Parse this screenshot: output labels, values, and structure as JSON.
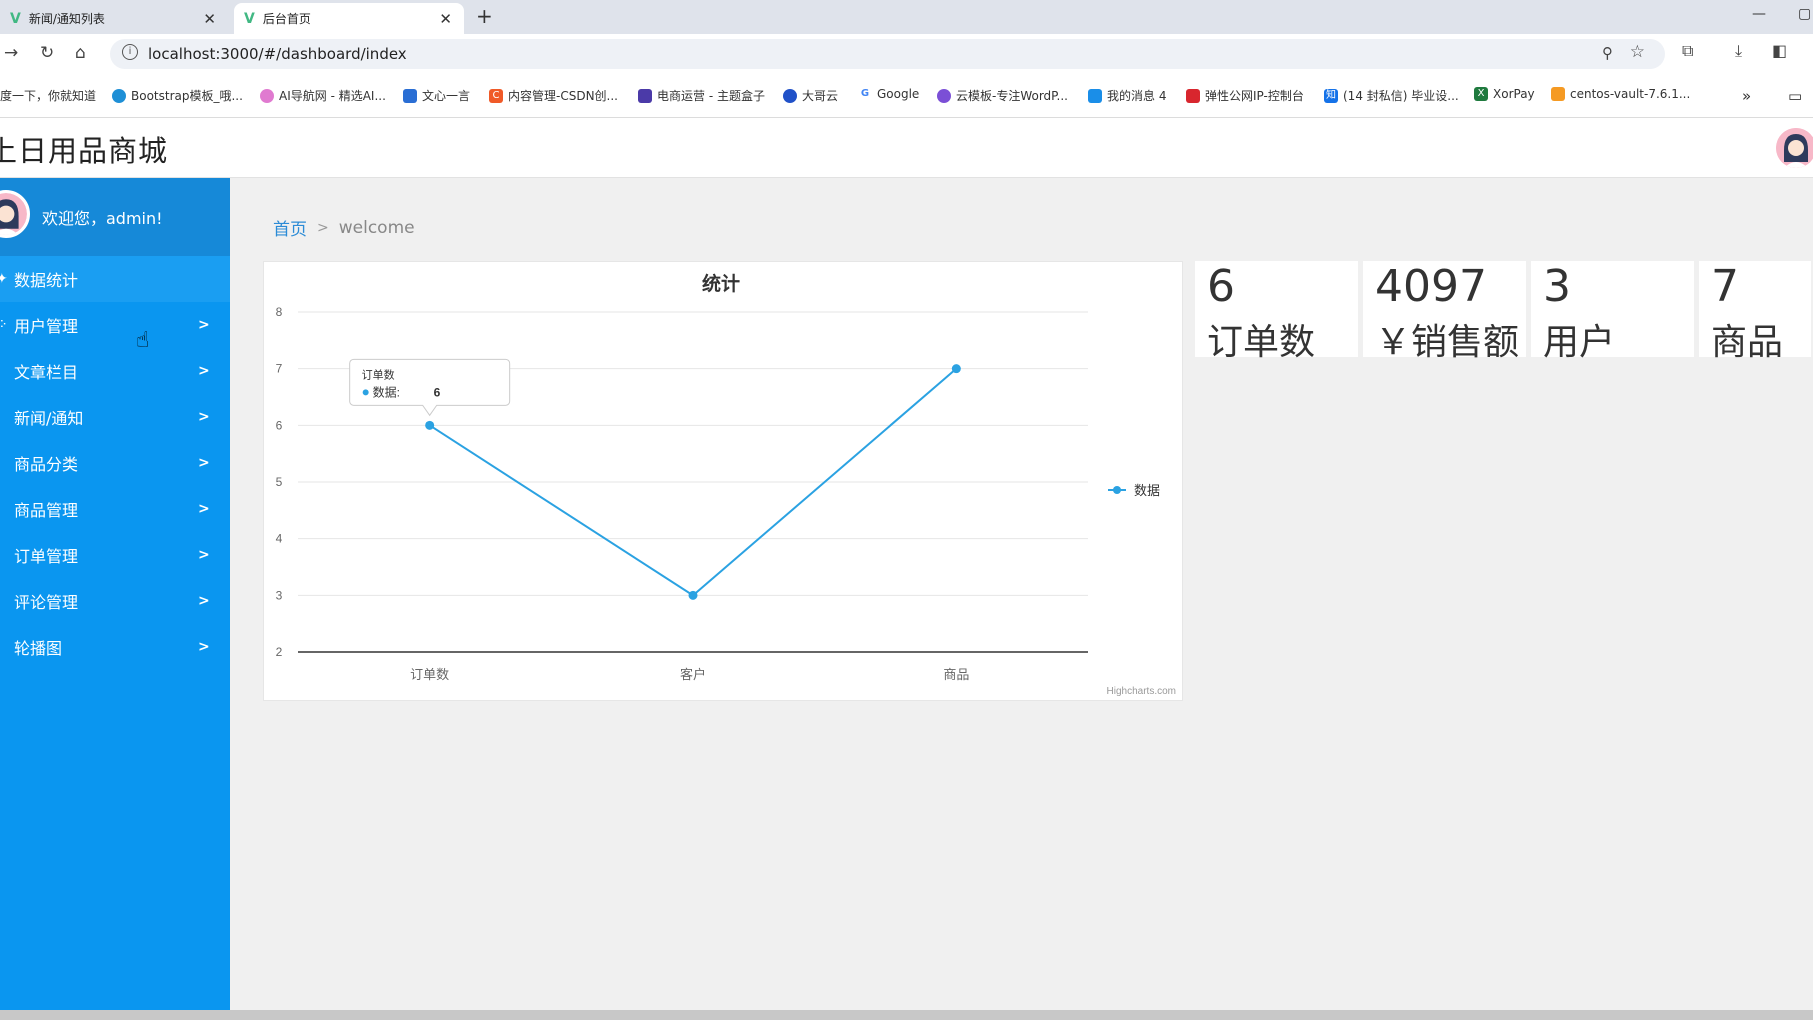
{
  "browser": {
    "tabs": [
      {
        "label": "新闻/通知列表"
      },
      {
        "label": "后台首页"
      }
    ],
    "url": "localhost:3000/#/dashboard/index",
    "bookmarks": [
      "度一下，你就知道",
      "Bootstrap模板_哦...",
      "AI导航网 - 精选AI...",
      "文心一言",
      "内容管理-CSDN创...",
      "电商运营 - 主题盒子",
      "大哥云",
      "Google",
      "云模板-专注WordP...",
      "我的消息 4",
      "弹性公网IP-控制台",
      "(14 封私信) 毕业设...",
      "XorPay",
      "centos-vault-7.6.1..."
    ]
  },
  "app": {
    "title": "上日用品商城",
    "welcome": "欢迎您，admin!"
  },
  "sidebar": {
    "items": [
      {
        "label": "数据统计"
      },
      {
        "label": "用户管理"
      },
      {
        "label": "文章栏目"
      },
      {
        "label": "新闻/通知"
      },
      {
        "label": "商品分类"
      },
      {
        "label": "商品管理"
      },
      {
        "label": "订单管理"
      },
      {
        "label": "评论管理"
      },
      {
        "label": "轮播图"
      }
    ]
  },
  "breadcrumb": {
    "home": "首页",
    "sep": ">",
    "current": "welcome"
  },
  "stats": [
    {
      "value": "6",
      "label": "订单数"
    },
    {
      "value": "4097",
      "label": "￥销售额"
    },
    {
      "value": "3",
      "label": "用户"
    },
    {
      "value": "7",
      "label": "商品"
    }
  ],
  "chart_data": {
    "type": "line",
    "title": "统计",
    "categories": [
      "订单数",
      "客户",
      "商品"
    ],
    "series": [
      {
        "name": "数据",
        "values": [
          6,
          3,
          7
        ],
        "color": "#2ba2e2"
      }
    ],
    "ylim": [
      2,
      8
    ],
    "yticks": [
      2,
      3,
      4,
      5,
      6,
      7,
      8
    ],
    "grid": true,
    "legend": "right",
    "credit": "Highcharts.com",
    "tooltip": {
      "category": "订单数",
      "series": "数据",
      "value": "6"
    }
  },
  "colors": {
    "sidebar": "#0a96f0",
    "accent": "#2ba2e2"
  }
}
